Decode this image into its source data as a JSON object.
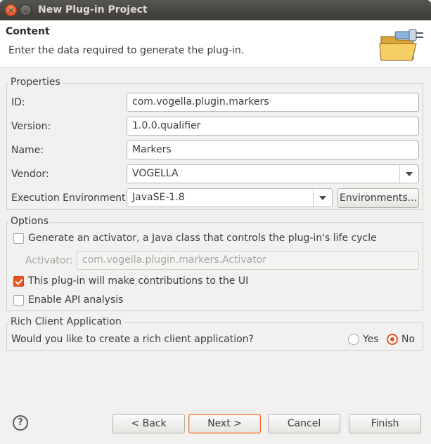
{
  "window": {
    "title": "New Plug-in Project"
  },
  "header": {
    "title": "Content",
    "description": "Enter the data required to generate the plug-in.",
    "icon": "wizard-folder-plug-icon"
  },
  "properties": {
    "group_label": "Properties",
    "id_label": "ID:",
    "id_value": "com.vogella.plugin.markers",
    "version_label": "Version:",
    "version_value": "1.0.0.qualifier",
    "name_label": "Name:",
    "name_value": "Markers",
    "vendor_label": "Vendor:",
    "vendor_value": "VOGELLA",
    "exec_env_label": "Execution Environment:",
    "exec_env_value": "JavaSE-1.8",
    "environments_button": "Environments..."
  },
  "options": {
    "group_label": "Options",
    "generate_activator_label": "Generate an activator, a Java class that controls the plug-in's life cycle",
    "generate_activator_checked": false,
    "activator_label": "Activator:",
    "activator_value": "com.vogella.plugin.markers.Activator",
    "contributions_label": "This plug-in will make contributions to the UI",
    "contributions_checked": true,
    "api_analysis_label": "Enable API analysis",
    "api_analysis_checked": false
  },
  "rcp": {
    "group_label": "Rich Client Application",
    "question": "Would you like to create a rich client application?",
    "yes_label": "Yes",
    "no_label": "No",
    "selected": "No"
  },
  "footer": {
    "help_glyph": "?",
    "back_button": "< Back",
    "next_button": "Next >",
    "cancel_button": "Cancel",
    "finish_button": "Finish"
  },
  "colors": {
    "accent": "#e95420",
    "background": "#f2f1f0"
  }
}
